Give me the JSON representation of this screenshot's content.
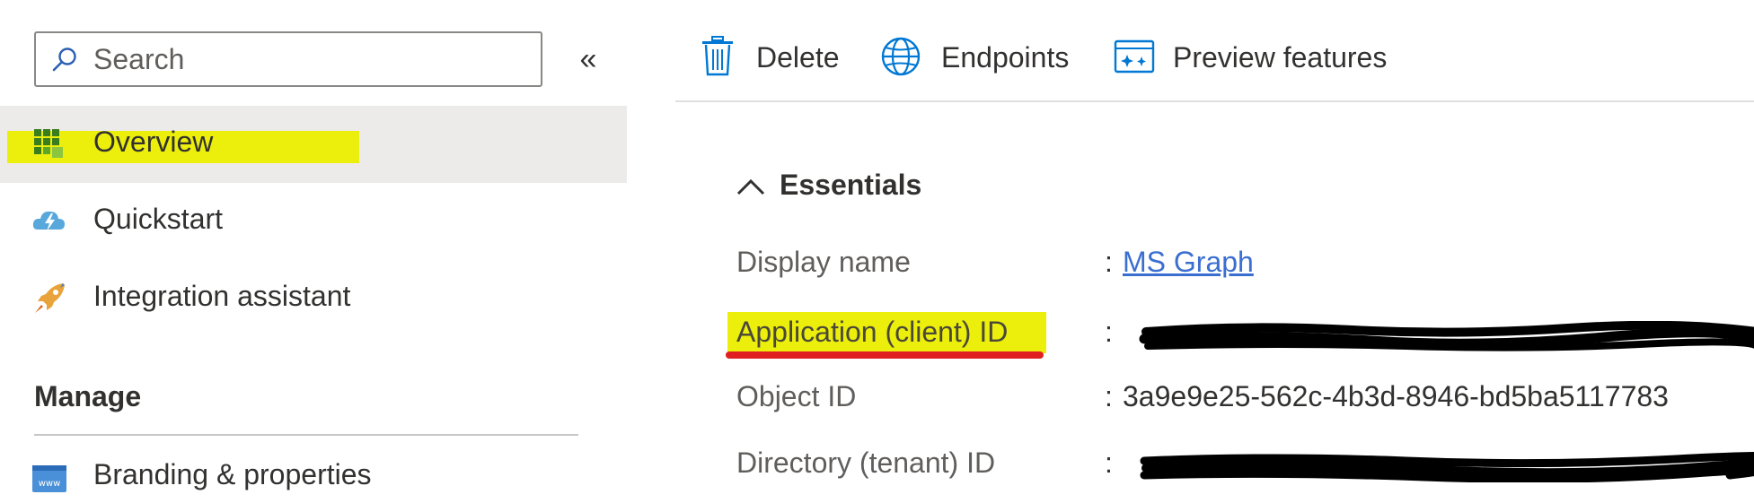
{
  "sidebar": {
    "search": {
      "placeholder": "Search",
      "value": ""
    },
    "collapse_label": "«",
    "items": [
      {
        "label": "Overview",
        "icon": "overview-grid-icon",
        "selected": true,
        "highlight": "#ecee0c"
      },
      {
        "label": "Quickstart",
        "icon": "cloud-lightning-icon",
        "selected": false
      },
      {
        "label": "Integration assistant",
        "icon": "rocket-icon",
        "selected": false
      }
    ],
    "manage": {
      "heading": "Manage",
      "items": [
        {
          "label": "Branding & properties",
          "icon": "www-window-icon"
        }
      ]
    }
  },
  "toolbar": {
    "delete_label": "Delete",
    "endpoints_label": "Endpoints",
    "preview_label": "Preview features"
  },
  "essentials": {
    "heading": "Essentials",
    "rows": [
      {
        "key": "Display name",
        "value": "MS Graph",
        "is_link": true
      },
      {
        "key": "Application (client) ID",
        "value": "",
        "redacted": true,
        "highlight": "#ecee0c",
        "underline": "#e02020"
      },
      {
        "key": "Object ID",
        "value": "3a9e9e25-562c-4b3d-8946-bd5ba5117783"
      },
      {
        "key": "Directory (tenant) ID",
        "value": "",
        "redacted": true
      }
    ],
    "separator": ":"
  },
  "colors": {
    "accent": "#0078d4",
    "link": "#3a6fd0",
    "selected_bg": "#edebe9",
    "highlight_yellow": "#ecee0c",
    "annotation_red": "#e02020"
  }
}
